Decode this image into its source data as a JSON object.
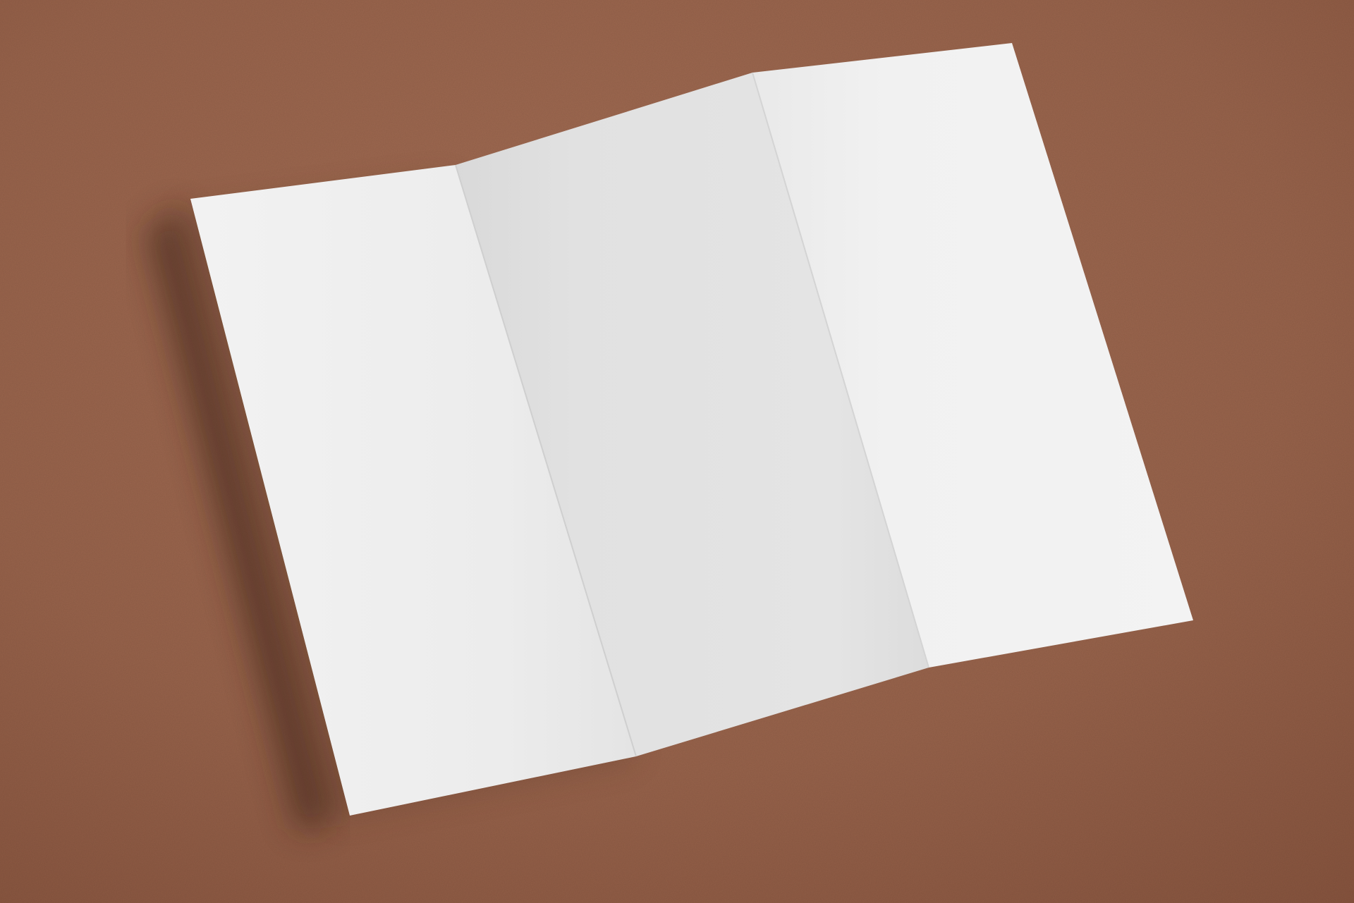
{
  "scene": {
    "subject": "trifold paper",
    "panels": 3,
    "colors": {
      "background": "#98634b",
      "background_light": "#a26c53",
      "background_dark": "#87543e",
      "paper_left": "#ededed",
      "paper_center": "#e2e2e2",
      "paper_right": "#f1f1f1",
      "shadow": "#3b2318"
    }
  }
}
